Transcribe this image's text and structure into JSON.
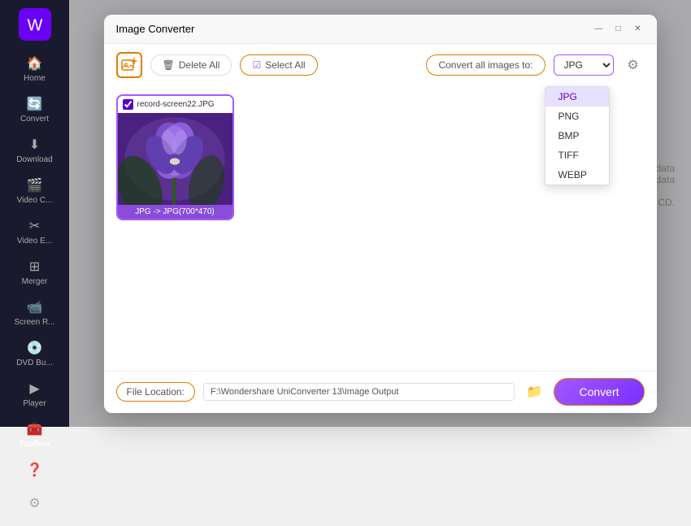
{
  "sidebar": {
    "items": [
      {
        "label": "Home",
        "icon": "🏠",
        "active": false
      },
      {
        "label": "Convert",
        "icon": "🔄",
        "active": false
      },
      {
        "label": "Download",
        "icon": "⬇",
        "active": false
      },
      {
        "label": "Video C...",
        "icon": "🎬",
        "active": false
      },
      {
        "label": "Video E...",
        "icon": "✂",
        "active": false
      },
      {
        "label": "Merger",
        "icon": "⊞",
        "active": false
      },
      {
        "label": "Screen R...",
        "icon": "📹",
        "active": false
      },
      {
        "label": "DVD Bu...",
        "icon": "💿",
        "active": false
      },
      {
        "label": "Player",
        "icon": "▶",
        "active": false
      },
      {
        "label": "Toolbox",
        "icon": "🧰",
        "active": true
      }
    ],
    "bottom_items": [
      {
        "label": "?",
        "icon": "❓"
      },
      {
        "label": "settings",
        "icon": "⚙"
      }
    ]
  },
  "modal": {
    "title": "Image Converter",
    "window_controls": [
      "—",
      "□",
      "✕"
    ]
  },
  "toolbar": {
    "delete_all_label": "Delete All",
    "select_all_label": "Select All",
    "convert_all_label": "Convert all images to:",
    "selected_format": "JPG"
  },
  "dropdown": {
    "options": [
      "JPG",
      "PNG",
      "BMP",
      "TIFF",
      "WEBP"
    ],
    "selected": "JPG"
  },
  "images": [
    {
      "filename": "record-screen22.JPG",
      "checked": true,
      "conversion_info": "JPG -> JPG(700*470)"
    }
  ],
  "footer": {
    "file_location_label": "File Location:",
    "file_path": "F:\\Wondershare UniConverter 13\\Image Output",
    "convert_button_label": "Convert"
  },
  "icons": {
    "add": "＋",
    "delete_trash": "🗑",
    "checkbox_checked": "✓",
    "gear": "⚙",
    "folder": "📁",
    "chevron_down": "▾",
    "minimize": "—",
    "maximize": "□",
    "close": "✕"
  }
}
